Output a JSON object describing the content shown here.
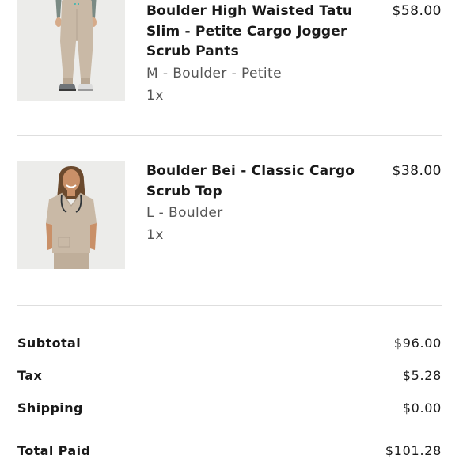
{
  "order_items": [
    {
      "name": "Boulder High Waisted Tatu Slim - Petite Cargo Jogger Scrub Pants",
      "variant": "M - Boulder - Petite",
      "quantity": "1x",
      "price": "$58.00",
      "image_icon": "product-photo-jogger-pants"
    },
    {
      "name": "Boulder Bei - Classic Cargo Scrub Top",
      "variant": "L - Boulder",
      "quantity": "1x",
      "price": "$38.00",
      "image_icon": "product-photo-scrub-top"
    }
  ],
  "summary": {
    "subtotal_label": "Subtotal",
    "subtotal_value": "$96.00",
    "tax_label": "Tax",
    "tax_value": "$5.28",
    "shipping_label": "Shipping",
    "shipping_value": "$0.00",
    "total_label": "Total Paid",
    "total_value": "$101.28"
  },
  "colors": {
    "product_tan": "#c9b9a6",
    "thumb_bg": "#ececea",
    "divider": "#dedede",
    "text_primary": "#1a1a1a",
    "text_secondary": "#555555"
  }
}
